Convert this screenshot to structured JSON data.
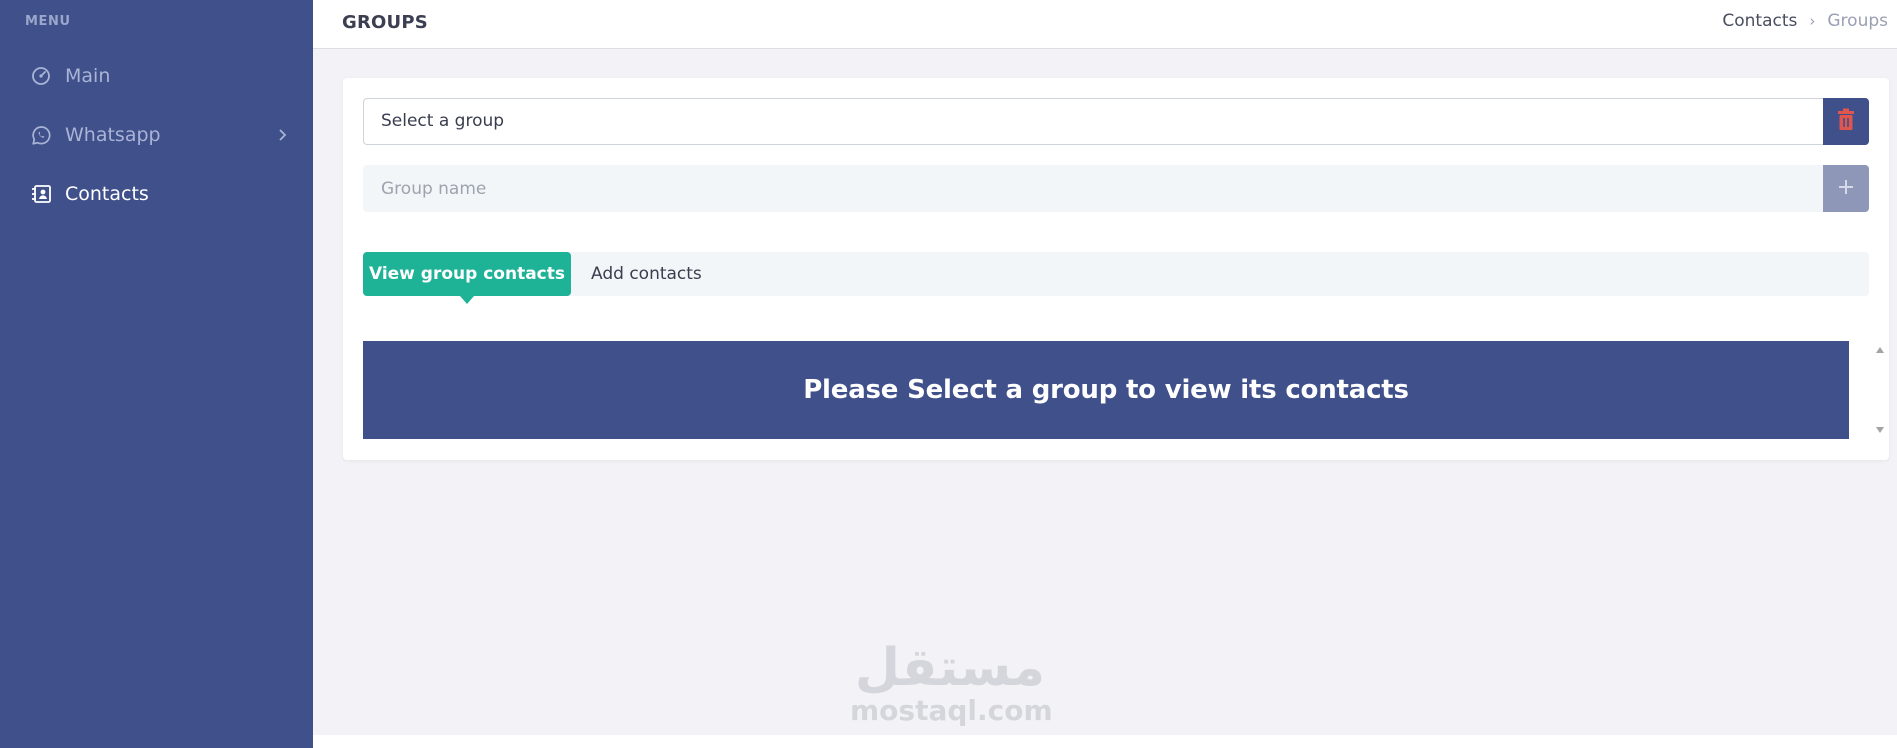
{
  "sidebar": {
    "menu_title": "MENU",
    "items": [
      {
        "label": "Main",
        "icon": "dashboard-gauge-icon"
      },
      {
        "label": "Whatsapp",
        "icon": "whatsapp-icon",
        "has_submenu": true
      },
      {
        "label": "Contacts",
        "icon": "contacts-book-icon",
        "active": true
      }
    ]
  },
  "header": {
    "title": "GROUPS",
    "breadcrumb": {
      "parent": "Contacts",
      "separator": "›",
      "current": "Groups"
    }
  },
  "form": {
    "select": {
      "selected": "Select a group"
    },
    "group_name": {
      "placeholder": "Group name",
      "value": ""
    },
    "delete_icon": "trash-icon",
    "add_icon": "plus-icon"
  },
  "tabs": [
    {
      "label": "View group contacts",
      "active": true
    },
    {
      "label": "Add contacts",
      "active": false
    }
  ],
  "banner": {
    "message": "Please Select a group to view its contacts"
  },
  "watermark": {
    "arabic": "مستقل",
    "latin": "mostaql.com"
  },
  "colors": {
    "sidebar": "#3f508a",
    "accent_green": "#1eb397",
    "delete_red": "#e0564f",
    "page_bg": "#f2f2f7"
  }
}
